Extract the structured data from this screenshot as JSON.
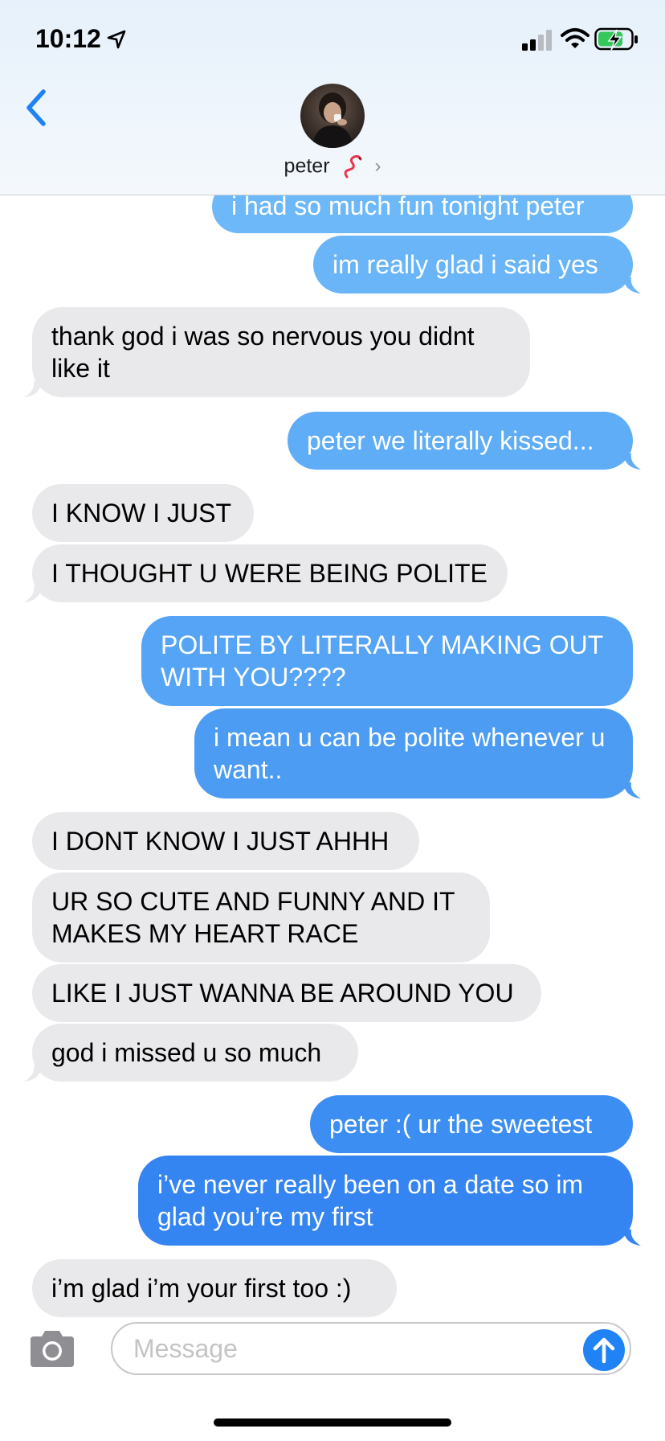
{
  "status_bar": {
    "time": "10:12"
  },
  "header": {
    "contact_name": "peter",
    "chevron": "›"
  },
  "messages": [
    {
      "dir": "out",
      "text": "i had so much fun tonight peter"
    },
    {
      "dir": "out",
      "text": "im really glad i said yes"
    },
    {
      "dir": "in",
      "text": "thank god i was so nervous you didnt like it"
    },
    {
      "dir": "out",
      "text": "peter we literally kissed..."
    },
    {
      "dir": "in",
      "text": "I KNOW I JUST"
    },
    {
      "dir": "in",
      "text": "I THOUGHT U WERE BEING POLITE"
    },
    {
      "dir": "out",
      "text": "POLITE BY LITERALLY MAKING OUT WITH YOU????"
    },
    {
      "dir": "out",
      "text": "i mean u can be polite whenever u want.."
    },
    {
      "dir": "in",
      "text": "I DONT KNOW I JUST AHHH"
    },
    {
      "dir": "in",
      "text": "UR SO CUTE AND FUNNY AND IT MAKES MY HEART RACE"
    },
    {
      "dir": "in",
      "text": "LIKE I JUST WANNA BE AROUND YOU"
    },
    {
      "dir": "in",
      "text": "god i missed u so much"
    },
    {
      "dir": "out",
      "text": "peter :( ur the sweetest"
    },
    {
      "dir": "out",
      "text": "i’ve never really been on a date so im glad you’re my first"
    },
    {
      "dir": "in",
      "text": "i’m glad i’m your first too :)"
    }
  ],
  "compose": {
    "placeholder": "Message"
  },
  "icons": {
    "back": "chevron-left-icon",
    "camera": "camera-icon",
    "send": "arrow-up-icon",
    "contact_emoji": "worm-emoji-icon"
  },
  "colors": {
    "outgoing_top": "#6cb8f8",
    "outgoing_bottom": "#2f7bf2",
    "incoming": "#e9e9eb",
    "accent": "#1f82f5"
  }
}
